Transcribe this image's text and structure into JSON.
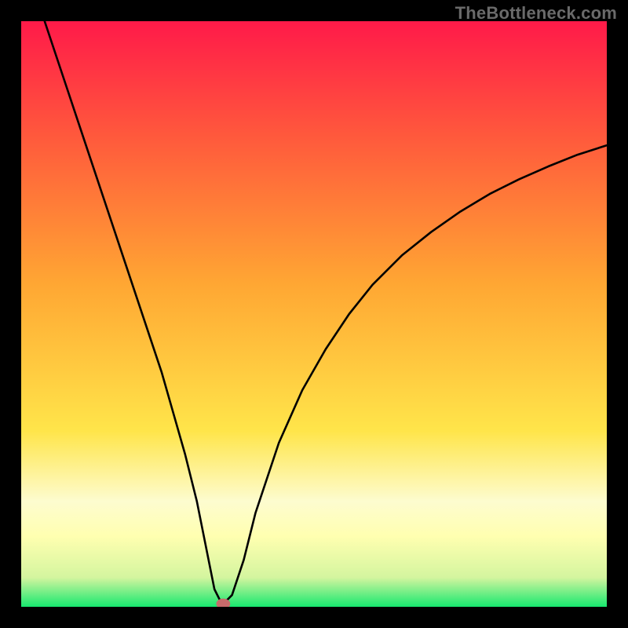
{
  "watermark": "TheBottleneck.com",
  "chart_data": {
    "type": "line",
    "title": "",
    "xlabel": "",
    "ylabel": "",
    "xlim": [
      0,
      100
    ],
    "ylim": [
      0,
      100
    ],
    "grid": false,
    "legend": false,
    "colors": {
      "curve": "#000000",
      "marker": "#c76b6b",
      "gradient_stops": [
        {
          "offset": 0.0,
          "color": "#ff1a49"
        },
        {
          "offset": 0.2,
          "color": "#ff5a3c"
        },
        {
          "offset": 0.45,
          "color": "#ffa733"
        },
        {
          "offset": 0.7,
          "color": "#ffe54a"
        },
        {
          "offset": 0.82,
          "color": "#fdfccf"
        },
        {
          "offset": 0.88,
          "color": "#ffffb0"
        },
        {
          "offset": 0.95,
          "color": "#d4f59f"
        },
        {
          "offset": 1.0,
          "color": "#17e86f"
        }
      ]
    },
    "series": [
      {
        "name": "bottleneck-curve",
        "x": [
          4,
          6,
          8,
          10,
          12,
          14,
          16,
          18,
          20,
          22,
          24,
          26,
          28,
          30,
          32,
          33,
          34,
          35,
          36,
          38,
          40,
          44,
          48,
          52,
          56,
          60,
          65,
          70,
          75,
          80,
          85,
          90,
          95,
          100
        ],
        "y": [
          100,
          94,
          88,
          82,
          76,
          70,
          64,
          58,
          52,
          46,
          40,
          33,
          26,
          18,
          8,
          3,
          1,
          1,
          2,
          8,
          16,
          28,
          37,
          44,
          50,
          55,
          60,
          64,
          67.5,
          70.5,
          73,
          75.2,
          77.2,
          78.8
        ]
      }
    ],
    "marker": {
      "x": 34.5,
      "y": 0.5,
      "rx": 1.2,
      "ry": 0.9
    }
  }
}
